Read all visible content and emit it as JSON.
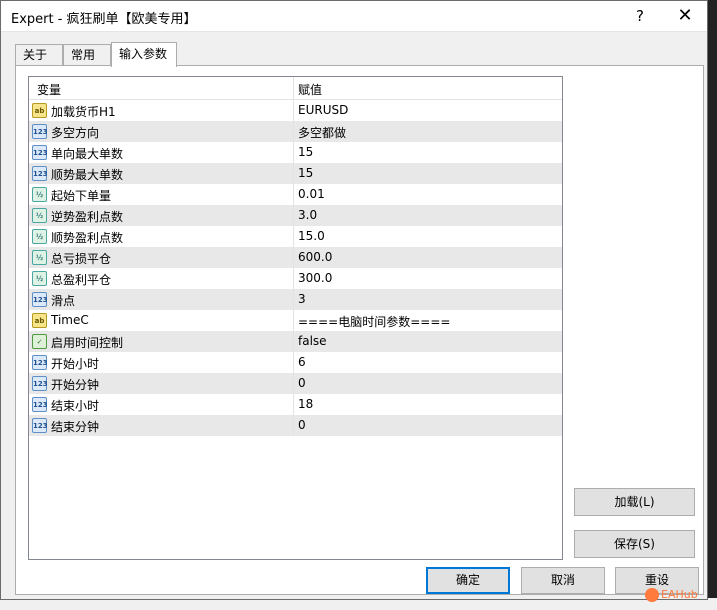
{
  "window": {
    "title": "Expert - 疯狂刷单【欧美专用】",
    "help": "?",
    "close": "✕"
  },
  "tabs": [
    "关于",
    "常用",
    "输入参数"
  ],
  "grid": {
    "headers": {
      "variable": "变量",
      "value": "赋值"
    },
    "rows": [
      {
        "type": "str",
        "icon": "ab",
        "name": "加载货币H1",
        "value": "EURUSD"
      },
      {
        "type": "int",
        "icon": "123",
        "name": "多空方向",
        "value": "多空都做"
      },
      {
        "type": "int",
        "icon": "123",
        "name": "单向最大单数",
        "value": "15"
      },
      {
        "type": "int",
        "icon": "123",
        "name": "顺势最大单数",
        "value": "15"
      },
      {
        "type": "dbl",
        "icon": "½",
        "name": "起始下单量",
        "value": "0.01"
      },
      {
        "type": "dbl",
        "icon": "½",
        "name": "逆势盈利点数",
        "value": "3.0"
      },
      {
        "type": "dbl",
        "icon": "½",
        "name": "顺势盈利点数",
        "value": "15.0"
      },
      {
        "type": "dbl",
        "icon": "½",
        "name": "总亏损平仓",
        "value": "600.0"
      },
      {
        "type": "dbl",
        "icon": "½",
        "name": "总盈利平仓",
        "value": "300.0"
      },
      {
        "type": "int",
        "icon": "123",
        "name": "滑点",
        "value": "3"
      },
      {
        "type": "str",
        "icon": "ab",
        "name": "TimeC",
        "value": "====电脑时间参数===="
      },
      {
        "type": "bool",
        "icon": "✓",
        "name": "启用时间控制",
        "value": "false"
      },
      {
        "type": "int",
        "icon": "123",
        "name": "开始小时",
        "value": "6"
      },
      {
        "type": "int",
        "icon": "123",
        "name": "开始分钟",
        "value": "0"
      },
      {
        "type": "int",
        "icon": "123",
        "name": "结束小时",
        "value": "18"
      },
      {
        "type": "int",
        "icon": "123",
        "name": "结束分钟",
        "value": "0"
      }
    ]
  },
  "buttons": {
    "load": "加载(L)",
    "save": "保存(S)",
    "ok": "确定",
    "cancel": "取消",
    "reset": "重设"
  },
  "watermark": "EAHub"
}
